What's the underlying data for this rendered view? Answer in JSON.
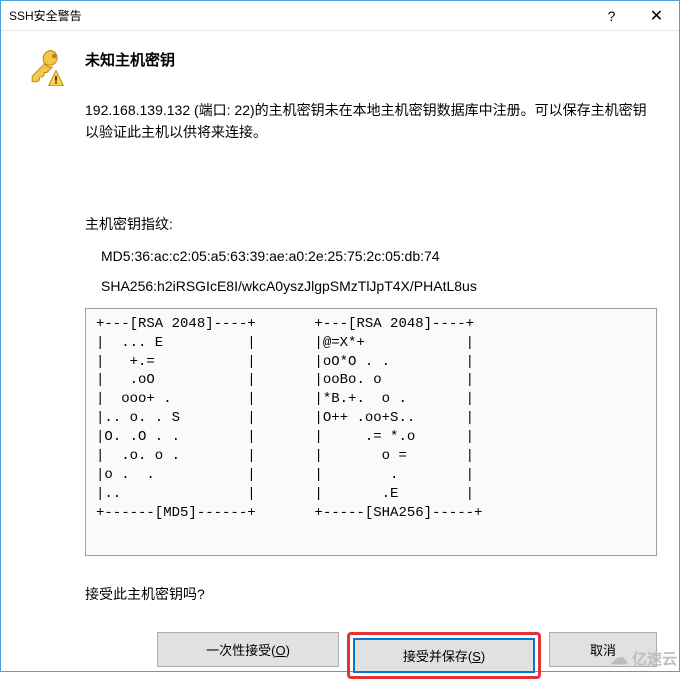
{
  "window": {
    "title": "SSH安全警告"
  },
  "heading": "未知主机密钥",
  "description": "192.168.139.132 (端口: 22)的主机密钥未在本地主机密钥数据库中注册。可以保存主机密钥以验证此主机以供将来连接。",
  "fingerprint": {
    "label": "主机密钥指纹:",
    "md5": "MD5:36:ac:c2:05:a5:63:39:ae:a0:2e:25:75:2c:05:db:74",
    "sha256": "SHA256:h2iRSGIcE8I/wkcA0yszJlgpSMzTlJpT4X/PHAtL8us"
  },
  "ascii_art": "+---[RSA 2048]----+       +---[RSA 2048]----+\n|  ... E          |       |@=X*+            |\n|   +.=           |       |oO*O . .         |\n|   .oO           |       |ooBo. o          |\n|  ooo+ .         |       |*B.+.  o .       |\n|.. o. . S        |       |O++ .oo+S..      |\n|O. .O . .        |       |     .= *.o      |\n|  .o. o .        |       |       o =       |\n|o .  .           |       |        .        |\n|..               |       |       .E        |\n+------[MD5]------+       +-----[SHA256]-----+",
  "question": "接受此主机密钥吗?",
  "buttons": {
    "once": "一次性接受(O)",
    "accept_save": "接受并保存(S)",
    "cancel": "取消"
  },
  "watermark": "亿速云"
}
